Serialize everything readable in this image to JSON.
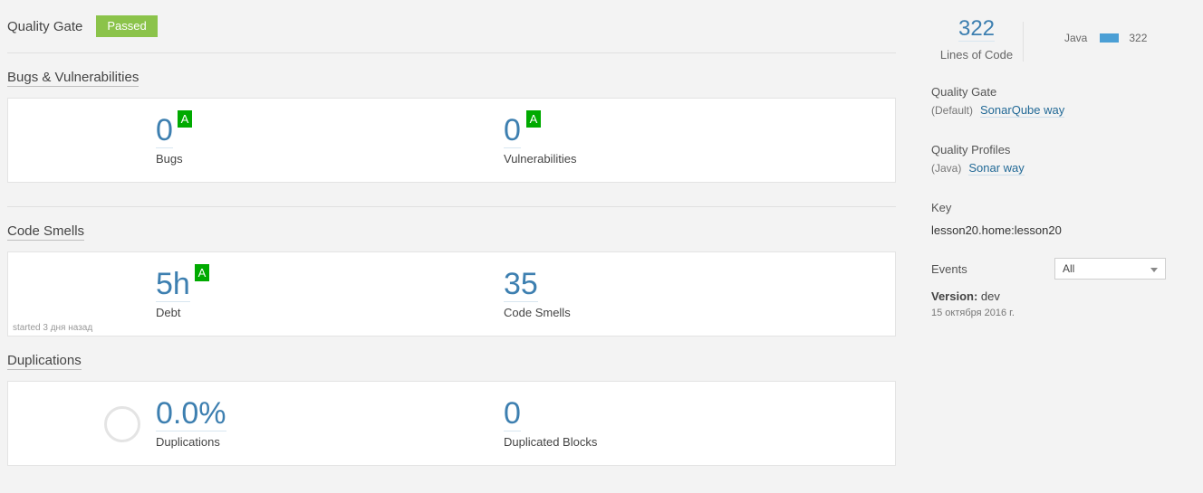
{
  "quality_gate": {
    "title": "Quality Gate",
    "status": "Passed"
  },
  "bugs_section": {
    "title": "Bugs & Vulnerabilities",
    "bugs": {
      "value": "0",
      "rating": "A",
      "label": "Bugs"
    },
    "vulnerabilities": {
      "value": "0",
      "rating": "A",
      "label": "Vulnerabilities"
    }
  },
  "smells_section": {
    "title": "Code Smells",
    "debt": {
      "value": "5h",
      "rating": "A",
      "label": "Debt"
    },
    "code_smells": {
      "value": "35",
      "label": "Code Smells"
    },
    "started": "started 3 дня назад"
  },
  "duplications_section": {
    "title": "Duplications",
    "duplications": {
      "value": "0.0%",
      "label": "Duplications"
    },
    "duplicated_blocks": {
      "value": "0",
      "label": "Duplicated Blocks"
    }
  },
  "sidebar": {
    "lines_of_code": {
      "value": "322",
      "label": "Lines of Code"
    },
    "language": {
      "name": "Java",
      "value": "322"
    },
    "quality_gate": {
      "heading": "Quality Gate",
      "prefix": "(Default)",
      "link": "SonarQube way"
    },
    "quality_profiles": {
      "heading": "Quality Profiles",
      "prefix": "(Java)",
      "link": "Sonar way"
    },
    "key": {
      "heading": "Key",
      "value": "lesson20.home:lesson20"
    },
    "events": {
      "heading": "Events",
      "filter_selected": "All"
    },
    "version": {
      "label": "Version:",
      "value": "dev",
      "date": "15 октября 2016 г."
    }
  },
  "colors": {
    "passed": "#8bc34a",
    "rating_a": "#00aa00",
    "link": "#236a97",
    "value": "#3d7fb0"
  }
}
